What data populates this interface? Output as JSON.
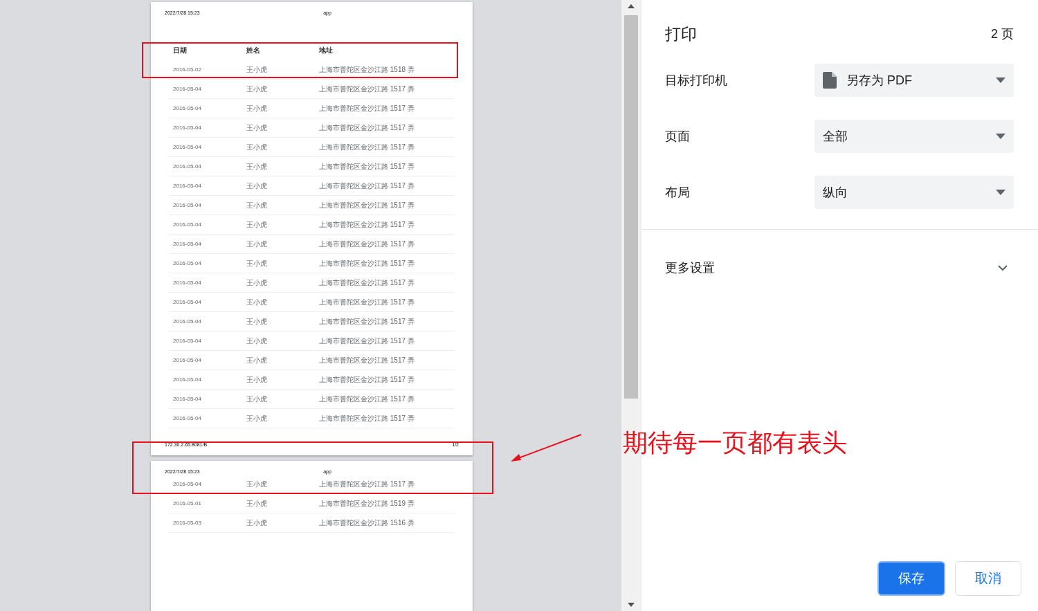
{
  "preview": {
    "pages": [
      {
        "header_left": "2022/7/28 15:23",
        "header_center": "app",
        "columns": [
          "日期",
          "姓名",
          "地址"
        ],
        "rows": [
          [
            "2016-05-02",
            "王小虎",
            "上海市普陀区金沙江路 1518 弄"
          ],
          [
            "2016-05-04",
            "王小虎",
            "上海市普陀区金沙江路 1517 弄"
          ],
          [
            "2016-05-04",
            "王小虎",
            "上海市普陀区金沙江路 1517 弄"
          ],
          [
            "2016-05-04",
            "王小虎",
            "上海市普陀区金沙江路 1517 弄"
          ],
          [
            "2016-05-04",
            "王小虎",
            "上海市普陀区金沙江路 1517 弄"
          ],
          [
            "2016-05-04",
            "王小虎",
            "上海市普陀区金沙江路 1517 弄"
          ],
          [
            "2016-05-04",
            "王小虎",
            "上海市普陀区金沙江路 1517 弄"
          ],
          [
            "2016-05-04",
            "王小虎",
            "上海市普陀区金沙江路 1517 弄"
          ],
          [
            "2016-05-04",
            "王小虎",
            "上海市普陀区金沙江路 1517 弄"
          ],
          [
            "2016-05-04",
            "王小虎",
            "上海市普陀区金沙江路 1517 弄"
          ],
          [
            "2016-05-04",
            "王小虎",
            "上海市普陀区金沙江路 1517 弄"
          ],
          [
            "2016-05-04",
            "王小虎",
            "上海市普陀区金沙江路 1517 弄"
          ],
          [
            "2016-05-04",
            "王小虎",
            "上海市普陀区金沙江路 1517 弄"
          ],
          [
            "2016-05-04",
            "王小虎",
            "上海市普陀区金沙江路 1517 弄"
          ],
          [
            "2016-05-04",
            "王小虎",
            "上海市普陀区金沙江路 1517 弄"
          ],
          [
            "2016-05-04",
            "王小虎",
            "上海市普陀区金沙江路 1517 弄"
          ],
          [
            "2016-05-04",
            "王小虎",
            "上海市普陀区金沙江路 1517 弄"
          ],
          [
            "2016-05-04",
            "王小虎",
            "上海市普陀区金沙江路 1517 弄"
          ],
          [
            "2016-05-04",
            "王小虎",
            "上海市普陀区金沙江路 1517 弄"
          ]
        ],
        "footer_left": "172.30.2.65:8081/B",
        "footer_right": "1/2"
      },
      {
        "header_left": "2022/7/28 15:23",
        "header_center": "app",
        "rows": [
          [
            "2016-05-04",
            "王小虎",
            "上海市普陀区金沙江路 1517 弄"
          ],
          [
            "2016-05-01",
            "王小虎",
            "上海市普陀区金沙江路 1519 弄"
          ],
          [
            "2016-05-03",
            "王小虎",
            "上海市普陀区金沙江路 1516 弄"
          ]
        ]
      }
    ]
  },
  "annotation": {
    "text": "期待每一页都有表头"
  },
  "settings": {
    "title": "打印",
    "page_count": "2 页",
    "fields": [
      {
        "label": "目标打印机",
        "value": "另存为 PDF",
        "has_icon": true
      },
      {
        "label": "页面",
        "value": "全部",
        "has_icon": false
      },
      {
        "label": "布局",
        "value": "纵向",
        "has_icon": false
      }
    ],
    "more": "更多设置",
    "buttons": [
      {
        "label": "保存",
        "kind": "primary"
      },
      {
        "label": "取消",
        "kind": "secondary"
      }
    ]
  }
}
